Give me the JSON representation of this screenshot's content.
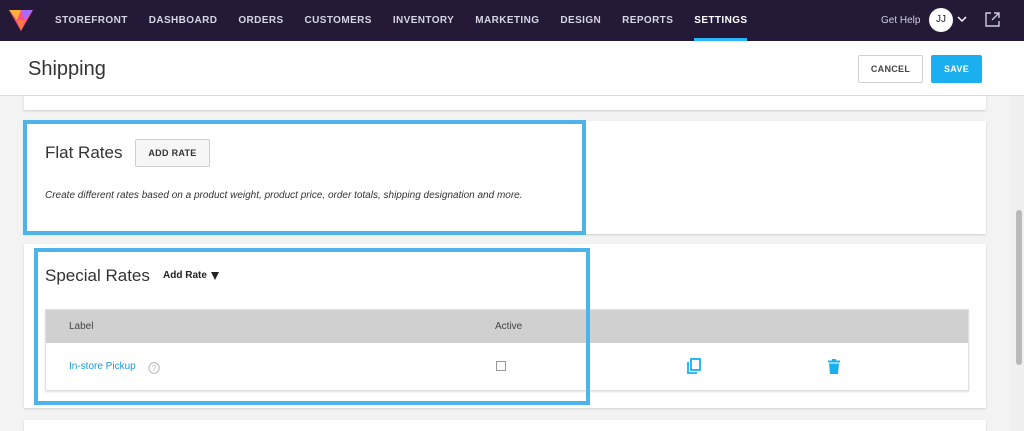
{
  "nav": {
    "items": [
      {
        "label": "STOREFRONT"
      },
      {
        "label": "DASHBOARD"
      },
      {
        "label": "ORDERS"
      },
      {
        "label": "CUSTOMERS"
      },
      {
        "label": "INVENTORY"
      },
      {
        "label": "MARKETING"
      },
      {
        "label": "DESIGN"
      },
      {
        "label": "REPORTS"
      },
      {
        "label": "SETTINGS",
        "active": true
      }
    ],
    "get_help": "Get Help",
    "avatar_initials": "JJ",
    "icons": {
      "logo": "brand-logo",
      "avatar_menu": "chevron-down-icon",
      "external": "external-link-icon"
    }
  },
  "header": {
    "title": "Shipping",
    "cancel_label": "CANCEL",
    "save_label": "SAVE"
  },
  "flat_rates": {
    "title": "Flat Rates",
    "add_label": "ADD RATE",
    "description": "Create different rates based on a product weight, product price, order totals, shipping designation and more."
  },
  "special_rates": {
    "title": "Special Rates",
    "add_label": "Add Rate",
    "columns": [
      "Label",
      "Active"
    ],
    "rows": [
      {
        "label": "In-store Pickup",
        "active": false,
        "icons": [
          "help-icon",
          "copy-icon",
          "trash-icon"
        ]
      }
    ]
  },
  "colors": {
    "nav_bg": "#241a38",
    "accent": "#1ab0ef",
    "highlight": "#4db3e8",
    "link": "#1a9ad6"
  }
}
